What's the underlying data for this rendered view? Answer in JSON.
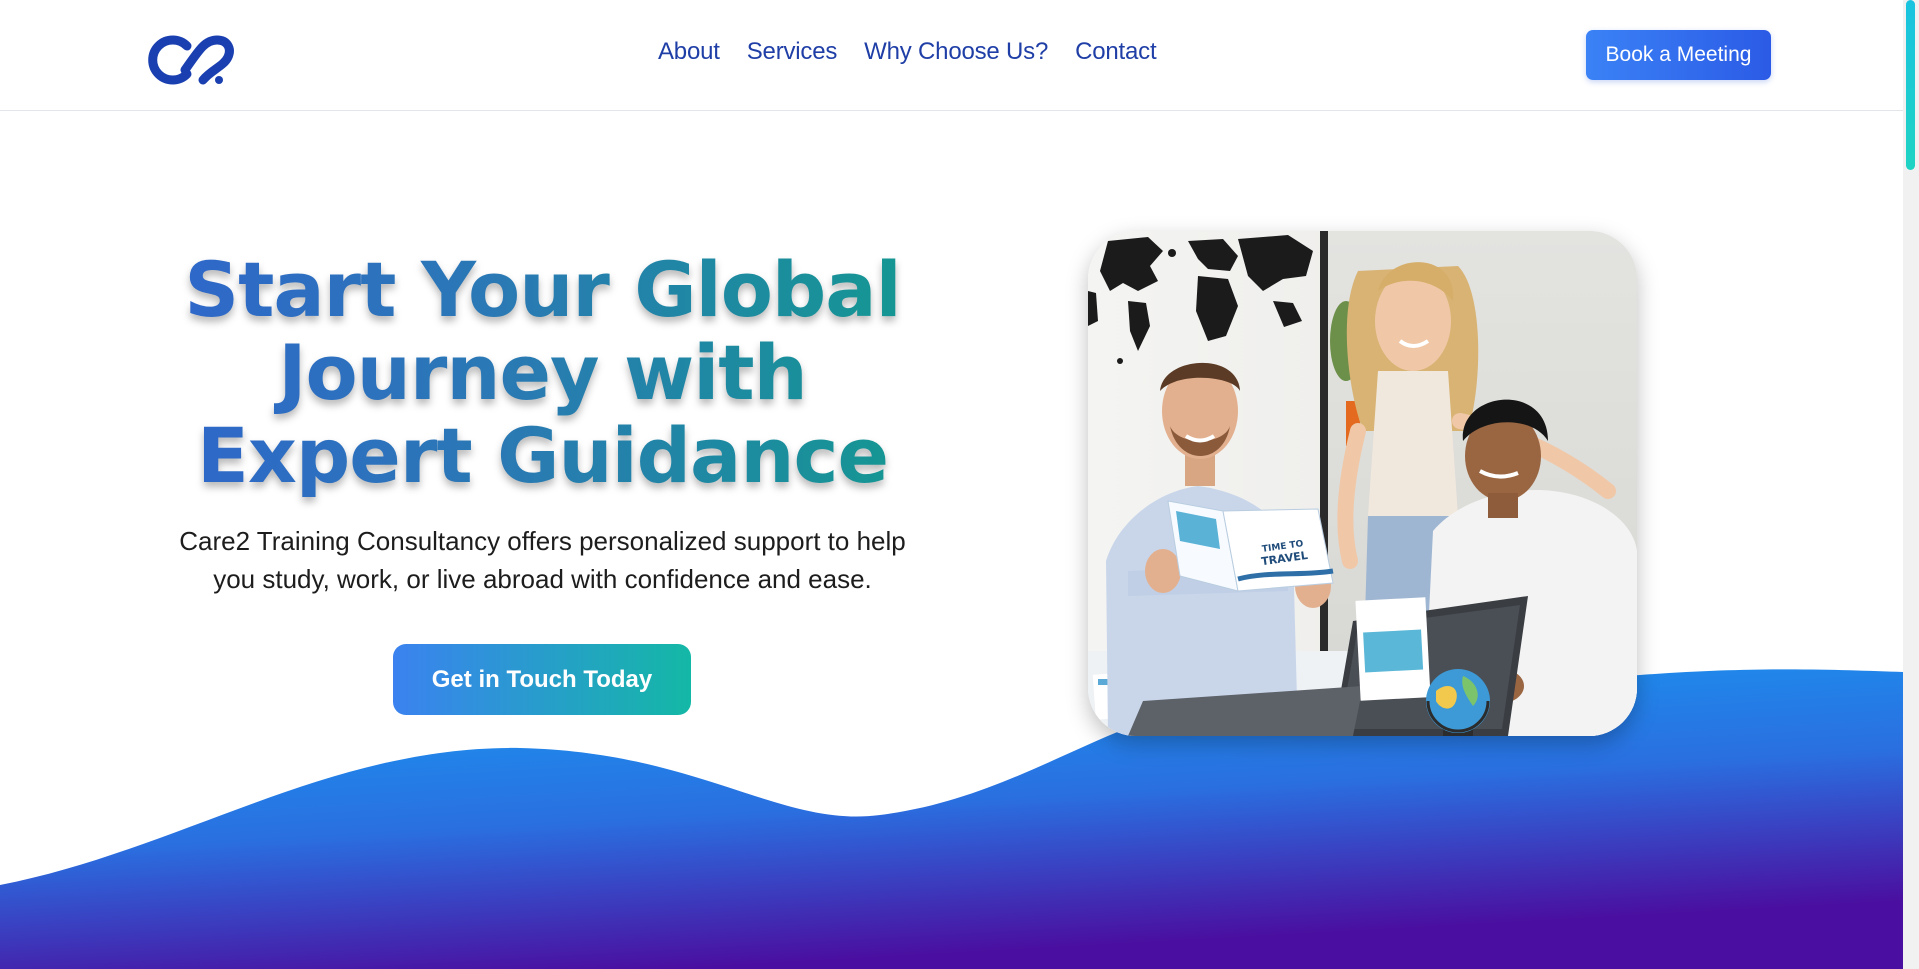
{
  "header": {
    "logo_icon": "care2-logo-icon",
    "nav": [
      "About",
      "Services",
      "Why Choose Us?",
      "Contact"
    ],
    "book_label": "Book a Meeting"
  },
  "hero": {
    "title_lines": [
      "Start Your Global",
      "Journey with",
      "Expert Guidance"
    ],
    "subtitle_lines": [
      "Care2 Training Consultancy offers personalized support to help",
      "you study, work, or live abroad with confidence and ease."
    ],
    "cta_label": "Get in Touch Today",
    "image": "team-planning-travel-photo",
    "brochure_text": [
      "TIME TO",
      "TRAVEL"
    ]
  },
  "colors": {
    "brand_blue": "#1f3fa7",
    "accent_teal": "#14b8a6",
    "wave_top": "#169ff5",
    "wave_bottom": "#4a0fa0"
  }
}
